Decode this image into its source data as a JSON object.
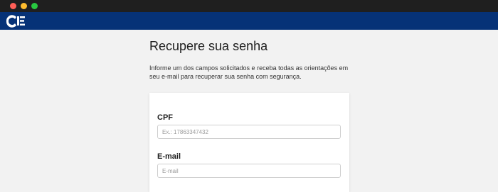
{
  "header": {
    "logo_icon": "ciee-logo-icon",
    "brand_color": "#063277"
  },
  "page": {
    "title": "Recupere sua senha",
    "description": "Informe um dos campos solicitados e receba todas as orientações em seu e-mail para recuperar sua senha com segurança."
  },
  "form": {
    "cpf_label": "CPF",
    "cpf_placeholder": "Ex.: 17863347432",
    "email_label": "E-mail",
    "email_placeholder": "E-mail"
  }
}
